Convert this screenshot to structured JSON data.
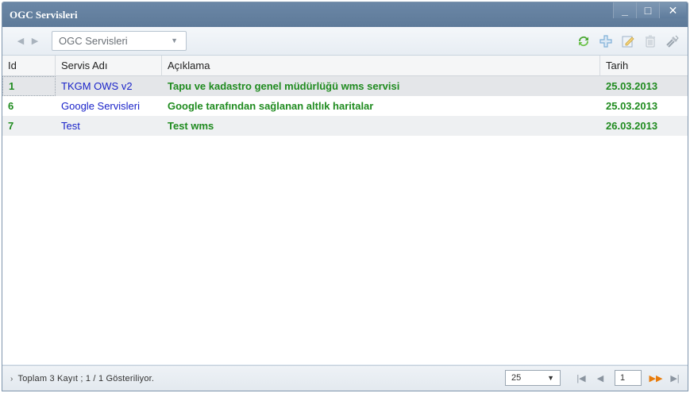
{
  "window": {
    "title": "OGC Servisleri",
    "controls": {
      "minimize": "_",
      "maximize": "□",
      "close": "✕"
    }
  },
  "toolbar": {
    "back": "◀",
    "forward": "▶",
    "combo_value": "OGC Servisleri",
    "combo_arrow": "▼",
    "icons": [
      "refresh-icon",
      "add-icon",
      "edit-icon",
      "delete-icon",
      "tools-icon"
    ],
    "colors": {
      "refresh": "#4aa832",
      "add": "#7fb0d8",
      "edit": "#9fb3c8",
      "delete": "#b9c2cc",
      "tools": "#9aa4ae"
    }
  },
  "grid": {
    "columns": [
      "Id",
      "Servis Adı",
      "Açıklama",
      "Tarih"
    ],
    "rows": [
      {
        "id": "1",
        "name": "TKGM OWS v2",
        "desc": "Tapu ve kadastro genel müdürlüğü wms servisi",
        "date": "25.03.2013"
      },
      {
        "id": "6",
        "name": "Google Servisleri",
        "desc": "Google tarafından sağlanan altlık haritalar",
        "date": "25.03.2013"
      },
      {
        "id": "7",
        "name": "Test",
        "desc": "Test wms",
        "date": "26.03.2013"
      }
    ]
  },
  "status": {
    "chevron": "›",
    "text": "Toplam 3 Kayıt ; 1 / 1 Gösteriliyor.",
    "page_size": "25",
    "page_size_arrow": "▼",
    "page": "1",
    "first": "|◀",
    "prev": "◀",
    "next": "▶▶",
    "last": "▶|",
    "end": "▶|"
  }
}
